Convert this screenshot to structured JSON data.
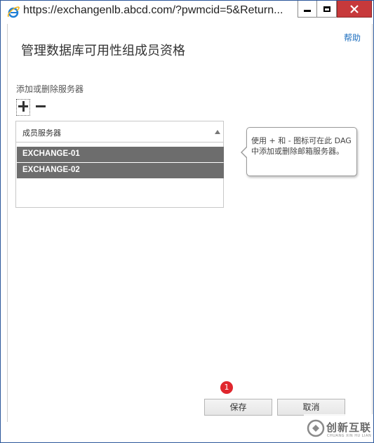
{
  "window": {
    "title": "https://exchangenlb.abcd.com/?pwmcid=5&Return..."
  },
  "header": {
    "help_label": "帮助",
    "title": "管理数据库可用性组成员资格"
  },
  "members": {
    "section_label": "添加或删除服务器",
    "column_header": "成员服务器",
    "rows": [
      {
        "name": "EXCHANGE-01"
      },
      {
        "name": "EXCHANGE-02"
      }
    ]
  },
  "tooltip": {
    "text": "使用 + 和 - 图标可在此 DAG 中添加或删除邮箱服务器。"
  },
  "footer": {
    "step_marker": "1",
    "save_label": "保存",
    "cancel_label": "取消"
  },
  "watermark": {
    "text": "创新互联"
  },
  "colors": {
    "selected_row": "#6d6d6d",
    "link": "#1e6fbf",
    "close_button": "#c7393b",
    "marker": "#e0262d"
  }
}
